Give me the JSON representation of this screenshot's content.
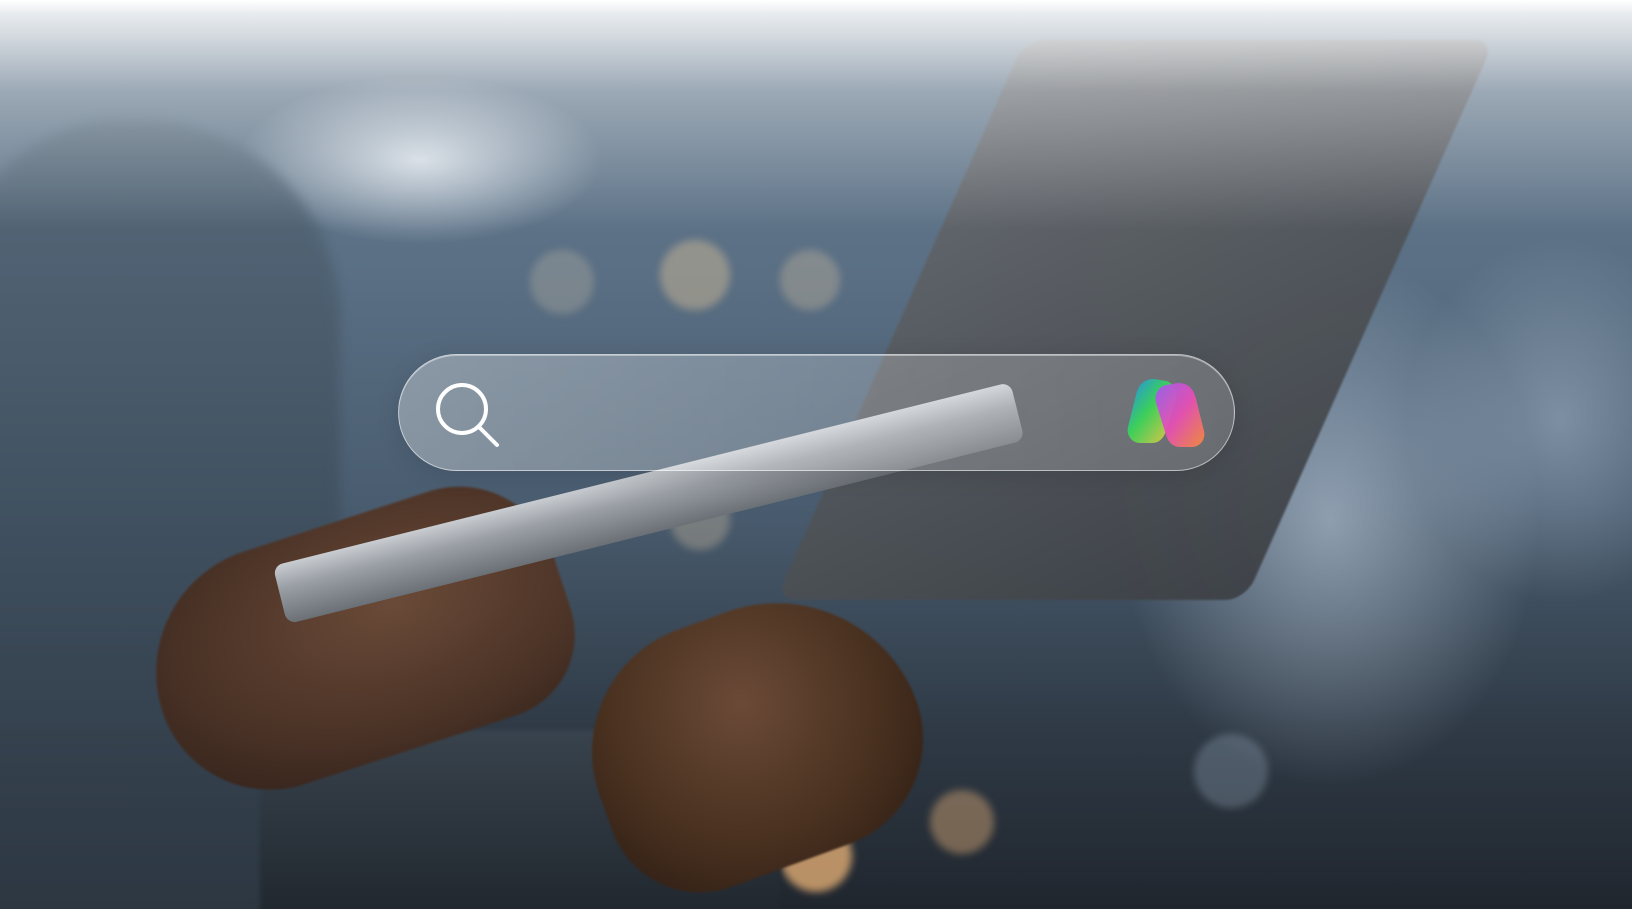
{
  "search": {
    "value": "",
    "placeholder": "",
    "search_icon": "search-icon",
    "assistant_icon": "copilot-logo-icon"
  },
  "colors": {
    "search_bar_border": "#ffffff",
    "icon_stroke": "#ffffff",
    "copilot_blue": "#1f8cf5",
    "copilot_green": "#3ccf5a",
    "copilot_yellow": "#f6c443",
    "copilot_pink": "#e64fb4",
    "copilot_purple": "#9c5cf0"
  }
}
